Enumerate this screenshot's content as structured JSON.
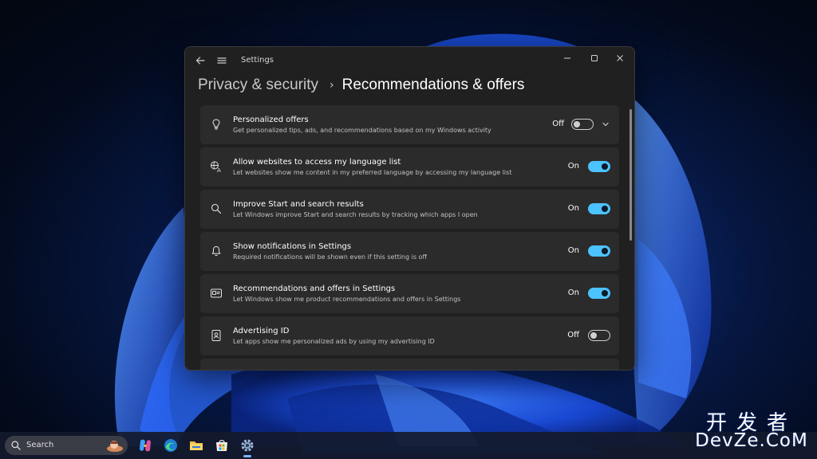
{
  "window": {
    "app_title": "Settings",
    "back_icon": "back-arrow-icon",
    "menu_icon": "hamburger-menu-icon"
  },
  "breadcrumb": {
    "parent": "Privacy & security",
    "separator": "›",
    "current": "Recommendations & offers"
  },
  "settings": [
    {
      "icon": "lightbulb-icon",
      "title": "Personalized offers",
      "description": "Get personalized tips, ads, and recommendations based on my Windows activity",
      "state": "Off",
      "on": false,
      "expandable": true
    },
    {
      "icon": "language-icon",
      "title": "Allow websites to access my language list",
      "description": "Let websites show me content in my preferred language by accessing my language list",
      "state": "On",
      "on": true
    },
    {
      "icon": "search-icon",
      "title": "Improve Start and search results",
      "description": "Let Windows improve Start and search results by tracking which apps I open",
      "state": "On",
      "on": true
    },
    {
      "icon": "bell-icon",
      "title": "Show notifications in Settings",
      "description": "Required notifications will be shown even if this setting is off",
      "state": "On",
      "on": true
    },
    {
      "icon": "offers-card-icon",
      "title": "Recommendations and offers in Settings",
      "description": "Let Windows show me product recommendations and offers in Settings",
      "state": "On",
      "on": true
    },
    {
      "icon": "advertising-id-icon",
      "title": "Advertising ID",
      "description": "Let apps show me personalized ads by using my advertising ID",
      "state": "Off",
      "on": false
    }
  ],
  "taskbar": {
    "search_label": "Search",
    "apps": [
      "copilot-icon",
      "edge-icon",
      "file-explorer-icon",
      "microsoft-store-icon",
      "settings-gear-icon"
    ]
  },
  "watermark": {
    "cn": "开发者",
    "en": "DevZe.CoM"
  },
  "colors": {
    "accent": "#4cc2ff",
    "window_bg": "#202020",
    "card_bg": "#2b2b2b"
  }
}
